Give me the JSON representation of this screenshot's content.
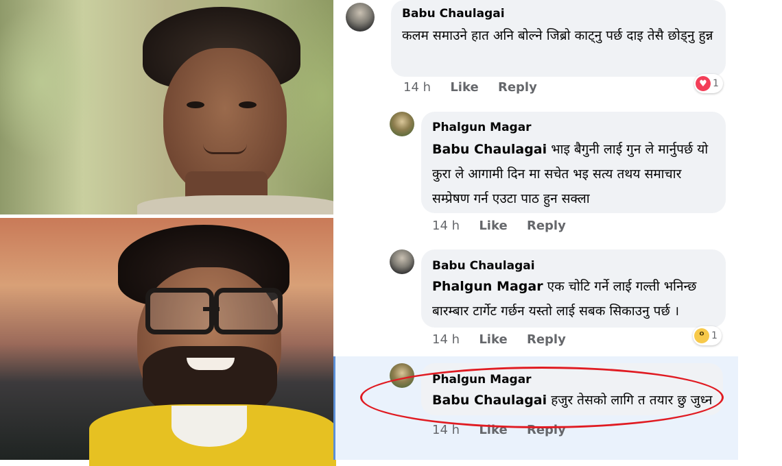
{
  "comments": [
    {
      "author": "Babu Chaulagai",
      "text": "कलम समाउने हात अनि बोल्ने जिब्रो काट्नु पर्छ दाइ तेसै छोड्नु हुन्न",
      "time": "14 h",
      "like_label": "Like",
      "reply_label": "Reply",
      "reaction": {
        "icon": "love-reaction-icon",
        "count": "1"
      }
    },
    {
      "author": "Phalgun Magar",
      "mention": "Babu Chaulagai",
      "text": "भाइ बैगुनी लाई गुन ले मार्नुपर्छ  यो कुरा ले आगामी दिन मा सचेत भइ सत्य तथय समाचार सम्प्रेषण  गर्न एउटा  पाठ हुन सक्ला",
      "time": "14 h",
      "like_label": "Like",
      "reply_label": "Reply"
    },
    {
      "author": "Babu Chaulagai",
      "mention": "Phalgun Magar",
      "text": "एक चोटि गर्ने लाई गल्ती भनिन्छ बारम्बार टार्गेट गर्छन यस्तो लाई सबक सिकाउनु पर्छ ।",
      "time": "14 h",
      "like_label": "Like",
      "reply_label": "Reply",
      "reaction": {
        "icon": "wow-reaction-icon",
        "count": "1"
      }
    },
    {
      "author": "Phalgun Magar",
      "mention": "Babu Chaulagai",
      "text": "हजुर तेसको लागि त तयार छु जुध्न",
      "time": "14 h",
      "like_label": "Like",
      "reply_label": "Reply"
    }
  ],
  "colors": {
    "bubble": "#f0f2f5",
    "highlight_row": "#eaf2fc",
    "annotation": "#e01b22",
    "love": "#f33e58",
    "wow": "#f7c94a"
  }
}
